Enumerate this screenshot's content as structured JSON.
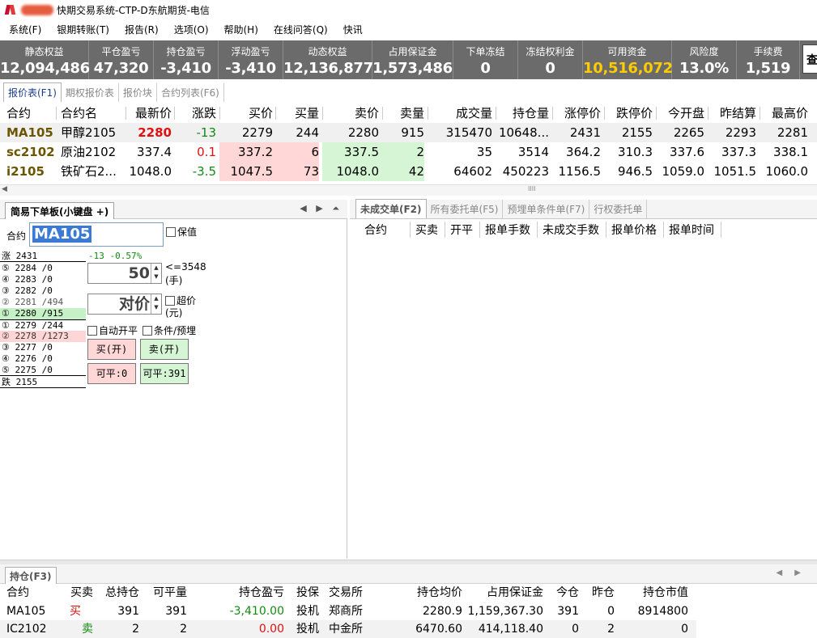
{
  "window": {
    "title": "快期交易系统-CTP-D东航期货-电信"
  },
  "menu": [
    "系统(F)",
    "银期转账(T)",
    "报告(R)",
    "选项(O)",
    "帮助(H)",
    "在线问答(Q)",
    "快讯"
  ],
  "stats": [
    {
      "label": "静态权益",
      "value": "12,094,486"
    },
    {
      "label": "平仓盈亏",
      "value": "47,320"
    },
    {
      "label": "持仓盈亏",
      "value": "-3,410"
    },
    {
      "label": "浮动盈亏",
      "value": "-3,410"
    },
    {
      "label": "动态权益",
      "value": "12,136,877"
    },
    {
      "label": "占用保证金",
      "value": "1,573,486"
    },
    {
      "label": "下单冻结",
      "value": "0"
    },
    {
      "label": "冻结权利金",
      "value": "0"
    },
    {
      "label": "可用资金",
      "value": "10,516,072"
    },
    {
      "label": "风险度",
      "value": "13.0%"
    },
    {
      "label": "手续费",
      "value": "1,519"
    }
  ],
  "query_button": "查",
  "quote_tabs": [
    "报价表(F1)",
    "期权报价表",
    "报价块",
    "合约列表(F6)"
  ],
  "quote_headers": [
    "合约",
    "合约名",
    "最新价",
    "涨跌",
    "买价",
    "买量",
    "卖价",
    "卖量",
    "成交量",
    "持仓量",
    "涨停价",
    "跌停价",
    "今开盘",
    "昨结算",
    "最高价"
  ],
  "quotes": [
    [
      "MA105",
      "甲醇2105",
      "2280",
      "-13",
      "2279",
      "244",
      "2280",
      "915",
      "315470",
      "10648...",
      "2431",
      "2155",
      "2265",
      "2293",
      "2281"
    ],
    [
      "sc2102",
      "原油2102",
      "337.4",
      "0.1",
      "337.2",
      "6",
      "337.5",
      "2",
      "35",
      "3514",
      "364.2",
      "310.3",
      "337.6",
      "337.3",
      "338.1"
    ],
    [
      "i2105",
      "铁矿石2...",
      "1048.0",
      "-3.5",
      "1047.5",
      "73",
      "1048.0",
      "42",
      "64602",
      "450223",
      "1156.5",
      "946.5",
      "1059.0",
      "1051.5",
      "1060.0"
    ]
  ],
  "quote_scroll_grip": "IIII",
  "order": {
    "tab": "简易下单板(小键盘 +)",
    "arrows": "◀ ▶ ⏶",
    "contract_label": "合约",
    "contract_value": "MA105",
    "hedge_label": "保值",
    "change_text": "-13 -0.57%",
    "depth": [
      "涨 2431",
      "⑤ 2284 /0",
      "④ 2283 /0",
      "③ 2282 /0",
      "② 2281 /494",
      "① 2280 /915",
      "① 2279 /244",
      "② 2278 /1273",
      "③ 2277 /0",
      "④ 2276 /0",
      "⑤ 2275 /0",
      "跌 2155"
    ],
    "qty_value": "50",
    "qty_limit": "<=3548",
    "qty_unit": "(手)",
    "price_value": "对价",
    "super_label": "超价",
    "price_unit": "(元)",
    "auto_label": "自动开平",
    "cond_label": "条件/预埋",
    "buy_label": "买(开)",
    "sell_label": "卖(开)",
    "buy_close": "可平:0",
    "sell_close": "可平:391"
  },
  "pending": {
    "tabs": [
      "未成交单(F2)",
      "所有委托单(F5)",
      "预埋单条件单(F7)",
      "行权委托单"
    ],
    "headers": [
      "合约",
      "买卖",
      "开平",
      "报单手数",
      "未成交手数",
      "报单价格",
      "报单时间"
    ]
  },
  "positions": {
    "tab": "持仓(F3)",
    "arrows": "◀ ▶",
    "headers": [
      "合约",
      "买卖",
      "总持仓",
      "可平量",
      "持仓盈亏",
      "投保",
      "交易所",
      "持仓均价",
      "占用保证金",
      "今仓",
      "昨仓",
      "持仓市值"
    ],
    "rows": [
      [
        "MA105",
        "买",
        "391",
        "391",
        "-3,410.00",
        "投机",
        "郑商所",
        "2280.9",
        "1,159,367.30",
        "391",
        "0",
        "8914800"
      ],
      [
        "IC2102",
        "卖",
        "2",
        "2",
        "0.00",
        "投机",
        "中金所",
        "6470.60",
        "414,118.40",
        "0",
        "2",
        "0"
      ]
    ]
  }
}
